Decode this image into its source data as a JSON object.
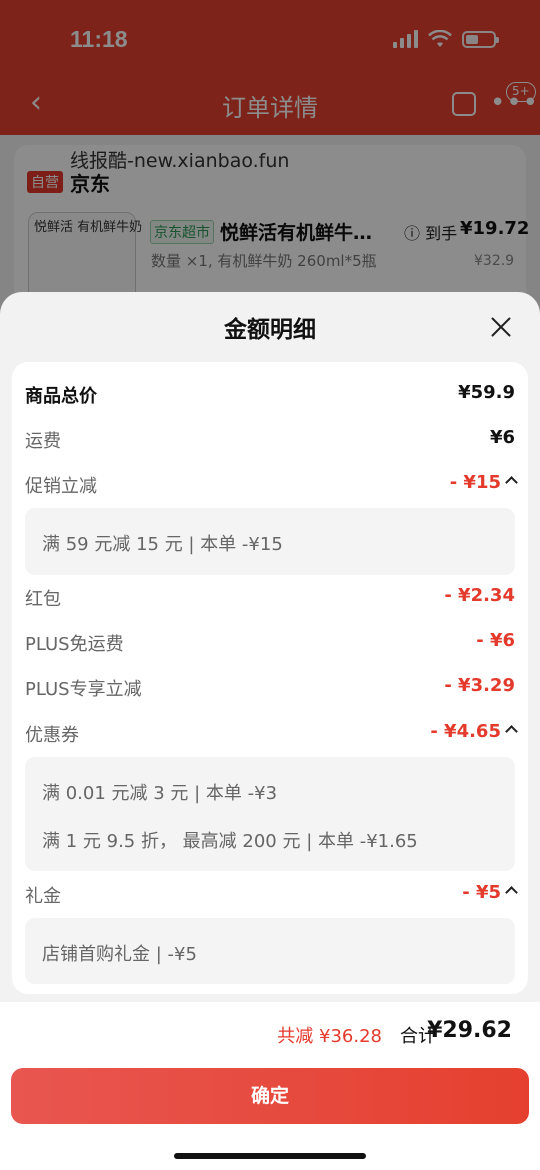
{
  "status_bar": {
    "time": "11:18"
  },
  "nav": {
    "back": "‹",
    "title": "订单详情",
    "badge": "5+",
    "more": "•••"
  },
  "background": {
    "watermark": "线报酷-new.xianbao.fun",
    "self_tag": "自营",
    "shop_name": "京东",
    "product_image_text": "悦鲜活 有机鲜牛奶",
    "product_tag": "京东超市",
    "product_name": "悦鲜活有机鲜牛…",
    "product_spec": "数量 ×1, 有机鲜牛奶 260ml*5瓶",
    "price_label": "到手",
    "price": "¥19.72",
    "original_price": "¥32.9"
  },
  "sheet": {
    "title": "金额明细",
    "rows": [
      {
        "label": "商品总价",
        "value": "¥59.9"
      },
      {
        "label": "运费",
        "value": "¥6"
      },
      {
        "label": "促销立减",
        "value": "- ¥15"
      },
      {
        "label": "红包",
        "value": "- ¥2.34"
      },
      {
        "label": "PLUS免运费",
        "value": "- ¥6"
      },
      {
        "label": "PLUS专享立减",
        "value": "- ¥3.29"
      },
      {
        "label": "优惠券",
        "value": "- ¥4.65"
      },
      {
        "label": "礼金",
        "value": "- ¥5"
      }
    ],
    "promo_detail": "满 59 元减 15 元 | 本单 -¥15",
    "coupon_details": [
      "满 0.01 元减 3 元 | 本单 -¥3",
      "满 1 元 9.5 折， 最高减 200 元 | 本单 -¥1.65"
    ],
    "gift_detail": "店铺首购礼金 | -¥5"
  },
  "footer": {
    "total_reduce": "共减 ¥36.28",
    "total_label": "合计",
    "total_price": "¥29.62",
    "confirm": "确定"
  },
  "colors": {
    "brand_red": "#e33a2c",
    "header_red": "#e5402f"
  }
}
